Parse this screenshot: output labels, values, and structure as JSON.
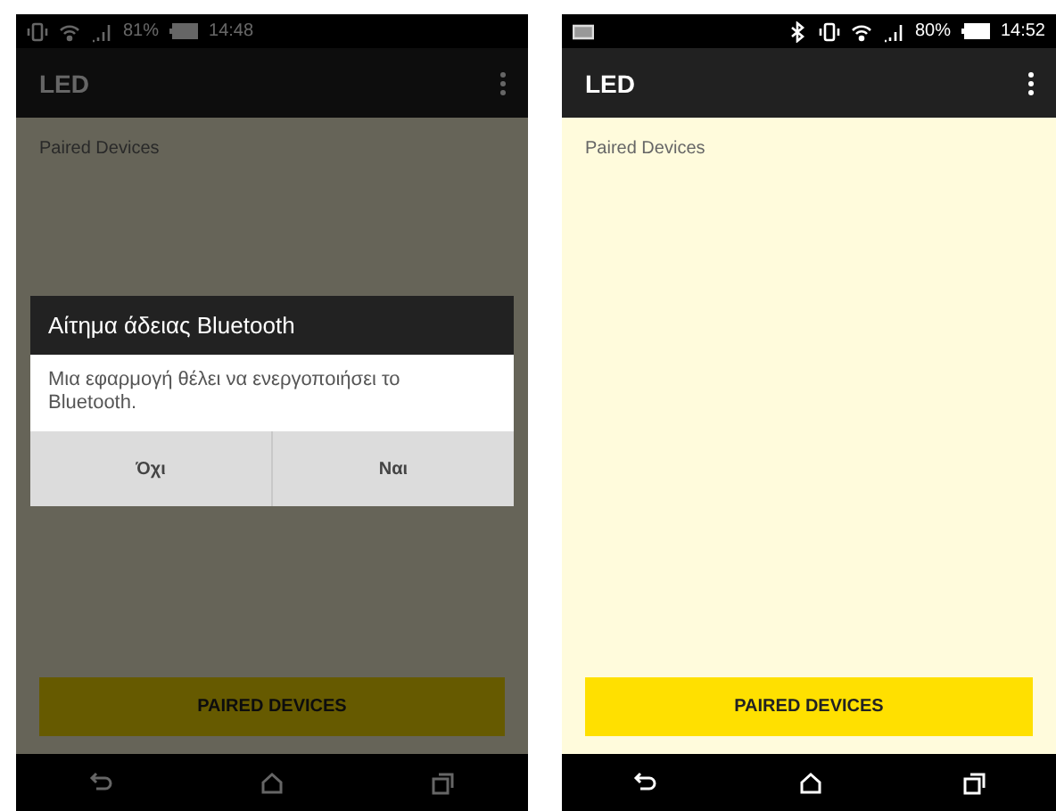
{
  "phones": [
    {
      "status_bar": {
        "icons": [
          {
            "kind": "vibrate"
          },
          {
            "kind": "wifi"
          },
          {
            "kind": "signal"
          }
        ],
        "battery": "81%",
        "time": "14:48"
      },
      "app_bar": {
        "title": "LED"
      },
      "section_label": "Paired Devices",
      "button": {
        "label": "PAIRED DEVICES"
      },
      "dialog": {
        "title": "Αίτημα άδειας Bluetooth",
        "message": "Μια εφαρμογή θέλει να ενεργοποιήσει το Bluetooth.",
        "buttons": [
          "Όχι",
          "Ναι"
        ]
      }
    },
    {
      "status_bar": {
        "icons": [
          {
            "kind": "notification"
          },
          {
            "kind": "bluetooth"
          },
          {
            "kind": "vibrate"
          },
          {
            "kind": "wifi"
          },
          {
            "kind": "signal"
          }
        ],
        "battery": "80%",
        "time": "14:52"
      },
      "app_bar": {
        "title": "LED"
      },
      "section_label": "Paired Devices",
      "button": {
        "label": "PAIRED DEVICES"
      }
    }
  ]
}
